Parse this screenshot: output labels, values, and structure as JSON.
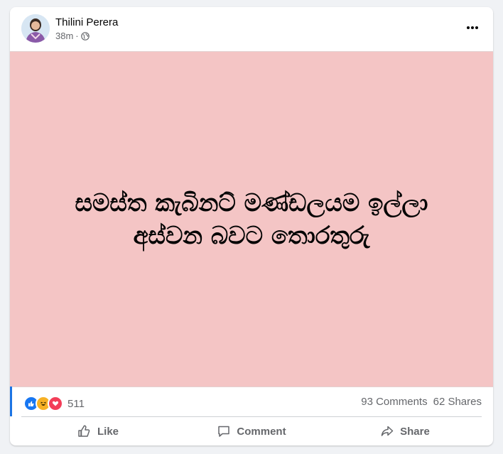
{
  "post": {
    "author": "Thilini Perera",
    "time": "38m",
    "separator": "·",
    "privacy_icon": "globe-icon",
    "menu_icon": "more-options-icon",
    "background_color": "#f4c5c5",
    "text_line1": "සමස්ත කැබිනට් මණ්ඩලයම ඉල්ලා",
    "text_line2": "අස්වන බවට තොරතුරු"
  },
  "stats": {
    "reaction_icons": [
      "like-icon",
      "haha-icon",
      "love-icon"
    ],
    "reaction_count": "511",
    "comments": "93 Comments",
    "shares": "62 Shares"
  },
  "actions": {
    "like": "Like",
    "comment": "Comment",
    "share": "Share"
  },
  "colors": {
    "like_blue": "#1877f2",
    "haha_yellow": "#f7b125",
    "love_red": "#f33e58",
    "secondary_text": "#65676b"
  }
}
